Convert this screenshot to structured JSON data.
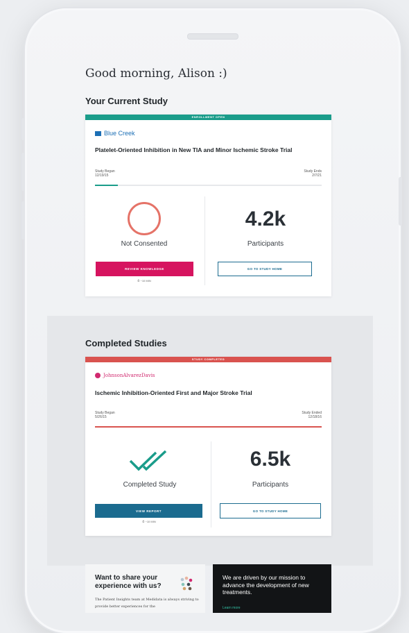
{
  "greeting": "Good morning, Alison :)",
  "current_section": {
    "title": "Your Current Study",
    "card": {
      "banner": "ENROLLMENT OPEN",
      "banner_color": "#1a9c8a",
      "sponsor": "Blue Creek",
      "trial_title": "Platelet-Oriented Inhibition in New TIA and Minor Ischemic Stroke Trial",
      "began_label": "Study Began",
      "began_date": "12/19/15",
      "ends_label": "Study Ends",
      "ends_date": "2/7/21",
      "progress_fraction": 0.1,
      "status_label": "Not Consented",
      "participants_count": "4.2k",
      "participants_label": "Participants",
      "primary_button": "REVIEW KNOWLEDGE",
      "primary_color": "#d6145f",
      "secondary_button": "GO TO STUDY HOME",
      "time_estimate": "⏱ ~10 MIN"
    }
  },
  "completed_section": {
    "title": "Completed Studies",
    "card": {
      "banner": "STUDY COMPLETED",
      "banner_color": "#d9534f",
      "sponsor": "JohnsonAlvarezDavis",
      "trial_title": "Ischemic Inhibition-Oriented First and Major Stroke Trial",
      "began_label": "Study Began",
      "began_date": "5/26/15",
      "ends_label": "Study Ended",
      "ends_date": "12/18/16",
      "progress_fraction": 1.0,
      "status_label": "Completed Study",
      "participants_count": "6.5k",
      "participants_label": "Participants",
      "primary_button": "VIEW REPORT",
      "primary_color": "#1b6b8f",
      "secondary_button": "GO TO STUDY HOME",
      "time_estimate": "⏱ ~10 MIN"
    }
  },
  "promo_left": {
    "title": "Want to share your experience with us?",
    "body": "The Patient Insights team at Medidata is always striving to provide better experiences for the"
  },
  "promo_right": {
    "title": "We are driven by our mission to advance the development of new treatments.",
    "link": "Learn more"
  }
}
